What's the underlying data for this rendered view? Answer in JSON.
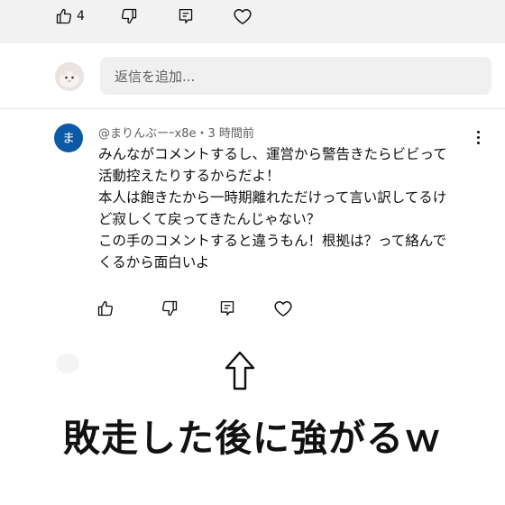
{
  "top_actions": {
    "like_count": "4"
  },
  "reply": {
    "placeholder": "返信を追加..."
  },
  "comment": {
    "avatar_letter": "ま",
    "meta": "@まりんぶーｰx8e・3 時間前",
    "lines": [
      "みんながコメントするし、運営から警告きたらビビって",
      "活動控えたりするからだよ！",
      "本人は飽きたから一時期離れただけって言い訳してるけ",
      "ど寂しくて戻ってきたんじゃない？",
      "この手のコメントすると違うもん！根拠は？って絡んで",
      "くるから面白いよ"
    ]
  },
  "caption": "敗走した後に強がるｗ",
  "colors": {
    "avatar_bg": "#0b5aa6",
    "top_band": "#f2f2f2",
    "reply_box": "#f0f0f0"
  }
}
